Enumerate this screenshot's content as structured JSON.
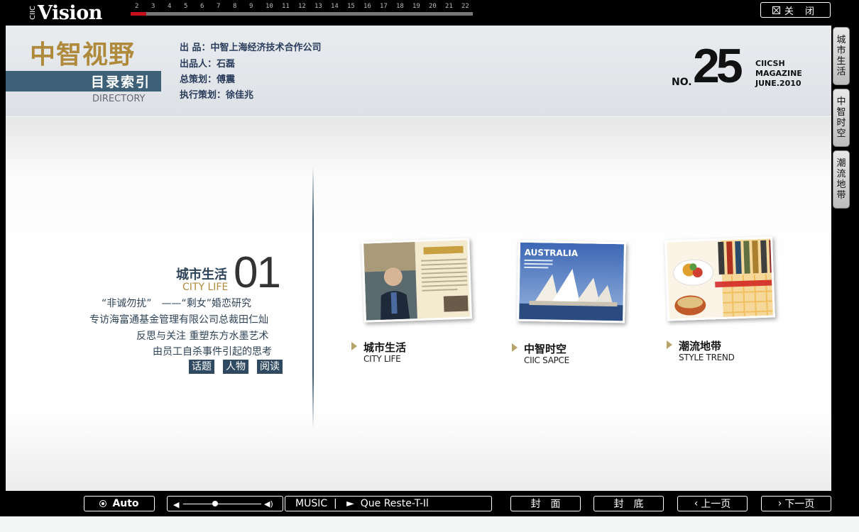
{
  "top": {
    "logo_small": "CIIC",
    "logo": "Vision",
    "page_numbers": [
      "2",
      "3",
      "4",
      "5",
      "6",
      "7",
      "8",
      "9",
      "10",
      "11",
      "12",
      "13",
      "14",
      "15",
      "16",
      "17",
      "18",
      "19",
      "20",
      "21",
      "22"
    ],
    "close_label": "关 闭"
  },
  "side_tabs": [
    "城市生活",
    "中智时空",
    "潮流地带"
  ],
  "header": {
    "brand_cn": "中智视野",
    "section_title": "目录索引",
    "section_en": "DIRECTORY",
    "credits": [
      "出 品：中智上海经济技术合作公司",
      "出品人：石磊",
      "总策划：傅震",
      "执行策划：徐佳兆"
    ],
    "issue_prefix": "NO.",
    "issue_number": "25",
    "mag_lines": [
      "CIICSH",
      "MAGAZINE",
      "JUNE.2010"
    ]
  },
  "section": {
    "title_cn": "城市生活",
    "title_en": "CITY LIFE",
    "number": "01",
    "articles": [
      "“非诚勿扰”　——“剩女”婚恋研究",
      "专访海富通基金管理有限公司总裁田仁灿",
      "反思与关注  重塑东方水墨艺术",
      "由员工自杀事件引起的思考"
    ],
    "tags": [
      "话题",
      "人物",
      "阅读"
    ]
  },
  "categories": [
    {
      "cn": "城市生活",
      "en": "CITY LIFE"
    },
    {
      "cn": "中智时空",
      "en": "CIIC SAPCE"
    },
    {
      "cn": "潮流地带",
      "en": "STYLE  TREND"
    }
  ],
  "thumbs": {
    "australia_label": "AUSTRALIA"
  },
  "bottom": {
    "auto_label": "Auto",
    "music_label": "MUSIC  |   ►  Que Reste-T-Il",
    "cover_label": "封　面",
    "back_cover_label": "封　底",
    "prev_label": "上一页",
    "next_label": "下一页"
  },
  "progress": {
    "current_page_fraction": 0.045
  },
  "colors": {
    "accent_red": "#c8101c",
    "brand_gold": "#b08a3c",
    "navy": "#2e4358",
    "bar_blue": "#3f6178"
  }
}
